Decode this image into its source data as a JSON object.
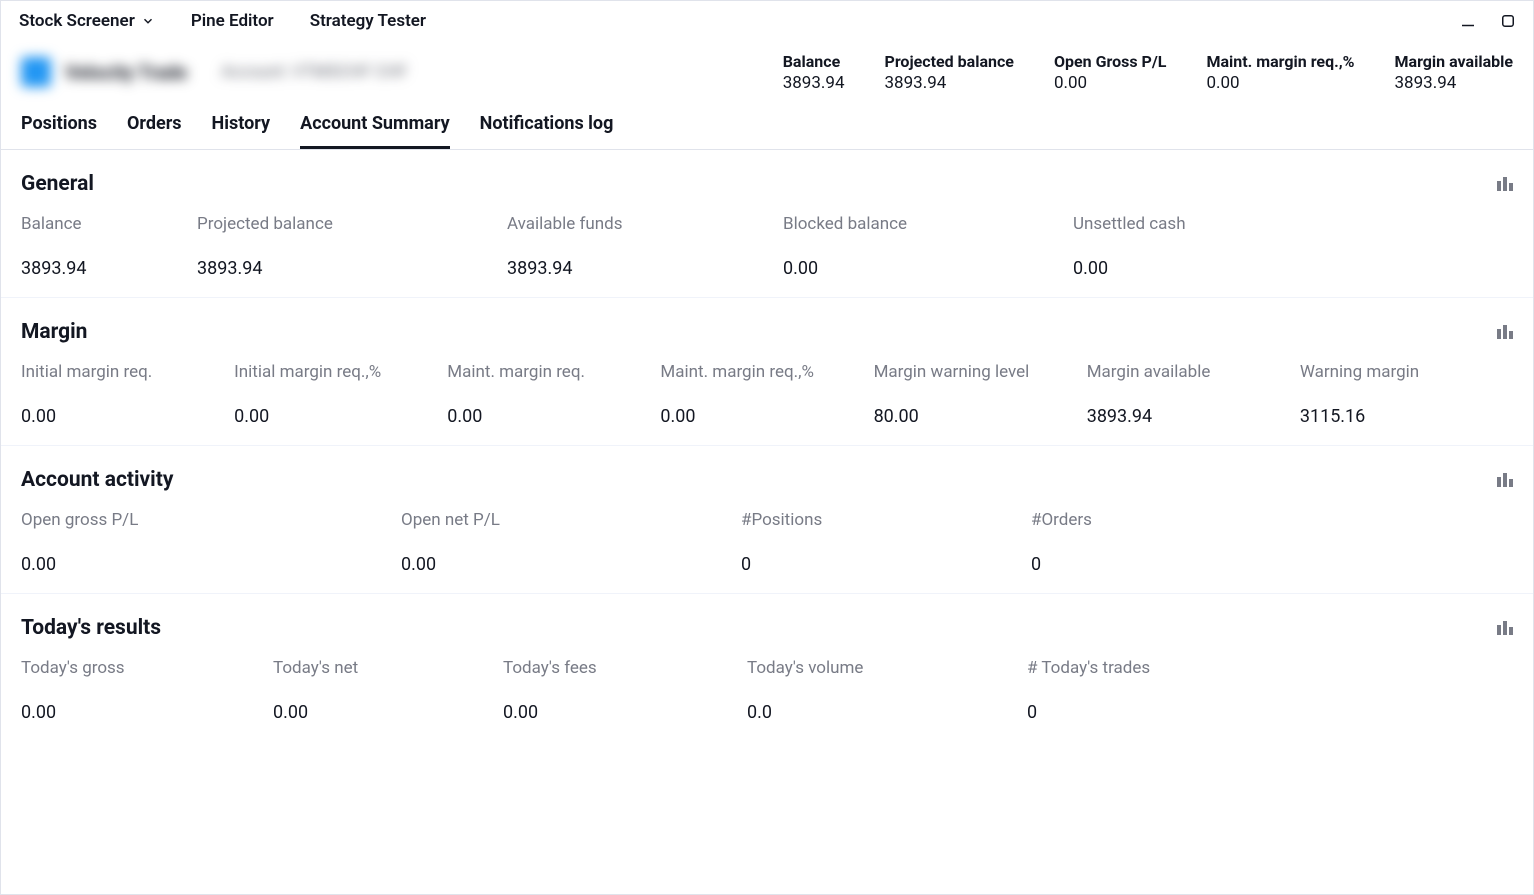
{
  "toolbar": {
    "stock_screener": "Stock Screener",
    "pine_editor": "Pine Editor",
    "strategy_tester": "Strategy Tester"
  },
  "account_header": {
    "broker_name": "Velocity Trade",
    "account_label": "Account: VTMSCHF CHF",
    "stats": [
      {
        "label": "Balance",
        "value": "3893.94"
      },
      {
        "label": "Projected balance",
        "value": "3893.94"
      },
      {
        "label": "Open Gross P/L",
        "value": "0.00"
      },
      {
        "label": "Maint. margin req.,%",
        "value": "0.00"
      },
      {
        "label": "Margin available",
        "value": "3893.94"
      }
    ]
  },
  "tabs": [
    {
      "label": "Positions",
      "active": false
    },
    {
      "label": "Orders",
      "active": false
    },
    {
      "label": "History",
      "active": false
    },
    {
      "label": "Account Summary",
      "active": true
    },
    {
      "label": "Notifications log",
      "active": false
    }
  ],
  "sections": {
    "general": {
      "title": "General",
      "fields": [
        {
          "label": "Balance",
          "value": "3893.94"
        },
        {
          "label": "Projected balance",
          "value": "3893.94"
        },
        {
          "label": "Available funds",
          "value": "3893.94"
        },
        {
          "label": "Blocked balance",
          "value": "0.00"
        },
        {
          "label": "Unsettled cash",
          "value": "0.00"
        }
      ]
    },
    "margin": {
      "title": "Margin",
      "fields": [
        {
          "label": "Initial margin req.",
          "value": "0.00"
        },
        {
          "label": "Initial margin req.,%",
          "value": "0.00"
        },
        {
          "label": "Maint. margin req.",
          "value": "0.00"
        },
        {
          "label": "Maint. margin req.,%",
          "value": "0.00"
        },
        {
          "label": "Margin warning level",
          "value": "80.00"
        },
        {
          "label": "Margin available",
          "value": "3893.94"
        },
        {
          "label": "Warning margin",
          "value": "3115.16"
        }
      ]
    },
    "activity": {
      "title": "Account activity",
      "fields": [
        {
          "label": "Open gross P/L",
          "value": "0.00"
        },
        {
          "label": "Open net P/L",
          "value": "0.00"
        },
        {
          "label": "#Positions",
          "value": "0"
        },
        {
          "label": "#Orders",
          "value": "0"
        }
      ]
    },
    "today": {
      "title": "Today's results",
      "fields": [
        {
          "label": "Today's gross",
          "value": "0.00"
        },
        {
          "label": "Today's net",
          "value": "0.00"
        },
        {
          "label": "Today's fees",
          "value": "0.00"
        },
        {
          "label": "Today's volume",
          "value": "0.0"
        },
        {
          "label": "# Today's trades",
          "value": "0"
        }
      ]
    }
  }
}
